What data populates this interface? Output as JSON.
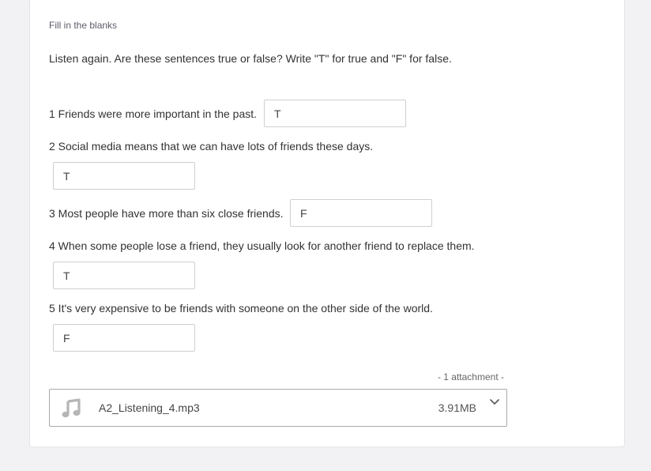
{
  "section_label": "Fill in the blanks",
  "instruction": "Listen again. Are these sentences true or false? Write \"T\" for true and \"F\" for false.",
  "questions": [
    {
      "text": "1 Friends were more important in the past.",
      "answer": "T"
    },
    {
      "text": "2 Social media means that we can have lots of friends these days.",
      "answer": "T"
    },
    {
      "text": "3 Most people have more than six close friends.",
      "answer": "F"
    },
    {
      "text": "4 When some people lose a friend, they usually look for another friend to replace them.",
      "answer": "T"
    },
    {
      "text": "5 It's very expensive to be friends with someone on the other side of the world.",
      "answer": "F"
    }
  ],
  "attachments": {
    "count_label": "- 1 attachment -",
    "items": [
      {
        "name": "A2_Listening_4.mp3",
        "size": "3.91MB",
        "icon": "music-note-icon"
      }
    ]
  }
}
